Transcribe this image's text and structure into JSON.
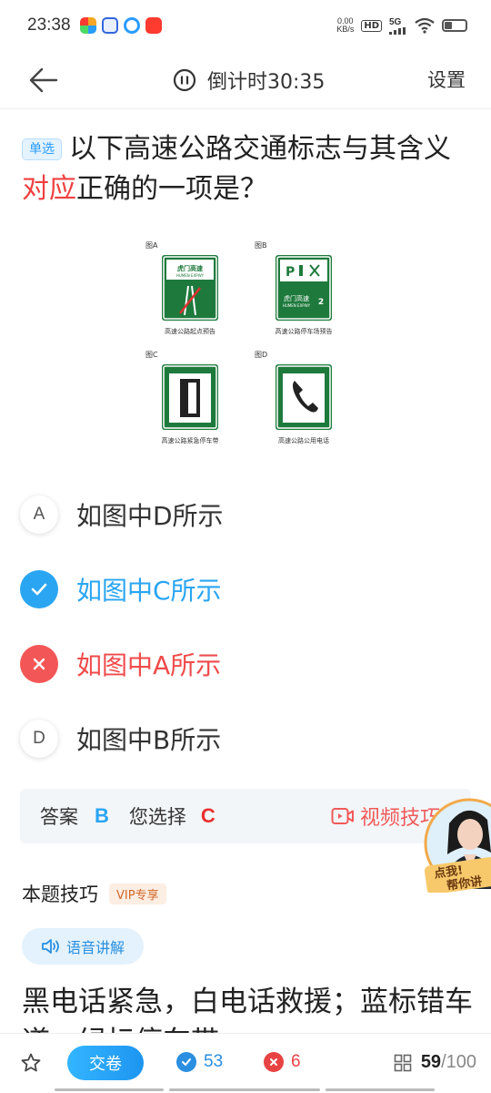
{
  "status_bar": {
    "time": "23:38",
    "net_speed_value": "0.00",
    "net_speed_unit": "KB/s",
    "hd": "HD",
    "network": "5G"
  },
  "header": {
    "timer_label": "倒计时30:35",
    "settings": "设置"
  },
  "question": {
    "type_badge": "单选",
    "text_before": "以下高速公路交通标志与其含义",
    "text_highlight": "对应",
    "text_after": "正确的一项是？"
  },
  "figure": {
    "panels": [
      {
        "tag": "图A",
        "caption": "高速公路起点预告",
        "sign_line1": "虎门高速",
        "sign_line2": "HUMEN EXPWY"
      },
      {
        "tag": "图B",
        "caption": "高速公路停车场预告",
        "sign_line1": "虎门高速",
        "sign_line2": "HUMEN EXPWY",
        "distance": "2"
      },
      {
        "tag": "图C",
        "caption": "高速公路紧急停车带"
      },
      {
        "tag": "图D",
        "caption": "高速公路公用电话"
      }
    ]
  },
  "options": [
    {
      "letter": "A",
      "text": "如图中D所示",
      "state": "normal"
    },
    {
      "letter": "B",
      "text": "如图中C所示",
      "state": "correct"
    },
    {
      "letter": "C",
      "text": "如图中A所示",
      "state": "wrong"
    },
    {
      "letter": "D",
      "text": "如图中B所示",
      "state": "normal"
    }
  ],
  "answer": {
    "label": "答案",
    "correct": "B",
    "chosen_label": "您选择",
    "chosen": "C",
    "video_tip": "视频技巧"
  },
  "teacher_float": {
    "cta_line1": "点我!",
    "cta_line2": "帮你讲"
  },
  "tips": {
    "title": "本题技巧",
    "vip": "VIP专享",
    "voice_btn": "语音讲解",
    "text": "黑电话紧急，白电话救援；蓝标错车道，绿标停车带"
  },
  "bottom": {
    "submit": "交卷",
    "correct_count": "53",
    "wrong_count": "6",
    "current": "59",
    "total": "/100"
  },
  "colors": {
    "accent": "#2aa5f2",
    "wrong": "#f04b4b",
    "sign_green": "#1e7a3c"
  }
}
